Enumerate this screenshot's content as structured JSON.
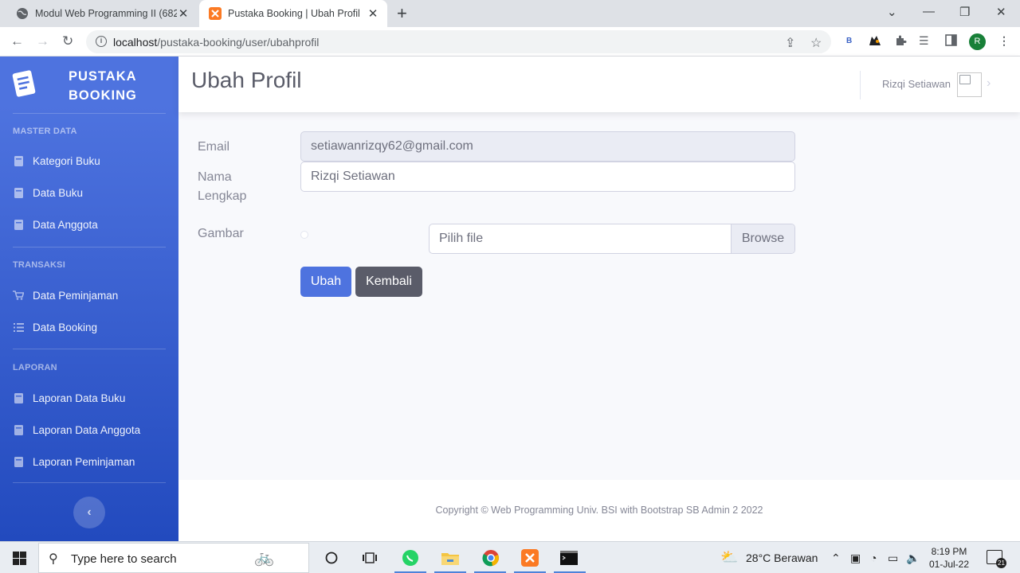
{
  "browser": {
    "tabs": [
      {
        "title": "Modul Web Programming II (682",
        "active": false,
        "icon": "globe-icon"
      },
      {
        "title": "Pustaka Booking | Ubah Profil",
        "active": true,
        "icon": "xampp-icon"
      }
    ],
    "url_host": "localhost",
    "url_path": "/pustaka-booking/user/ubahprofil",
    "profile_initial": "R",
    "extension_b": "B"
  },
  "sidebar": {
    "brand": {
      "line1": "PUSTAKA",
      "line2": "BOOKING"
    },
    "sections": [
      {
        "heading": "MASTER DATA",
        "items": [
          {
            "label": "Kategori Buku",
            "icon": "book-icon"
          },
          {
            "label": "Data Buku",
            "icon": "book-icon"
          },
          {
            "label": "Data Anggota",
            "icon": "book-icon"
          }
        ]
      },
      {
        "heading": "TRANSAKSI",
        "items": [
          {
            "label": "Data Peminjaman",
            "icon": "cart-icon"
          },
          {
            "label": "Data Booking",
            "icon": "list-icon"
          }
        ]
      },
      {
        "heading": "LAPORAN",
        "items": [
          {
            "label": "Laporan Data Buku",
            "icon": "book-icon"
          },
          {
            "label": "Laporan Data Anggota",
            "icon": "book-icon"
          },
          {
            "label": "Laporan Peminjaman",
            "icon": "book-icon"
          }
        ]
      }
    ],
    "toggle_icon": "chevron-left-icon"
  },
  "topbar": {
    "page_title": "Ubah Profil",
    "user_name": "Rizqi Setiawan"
  },
  "form": {
    "email_label": "Email",
    "email_value": "setiawanrizqy62@gmail.com",
    "name_label_1": "Nama",
    "name_label_2": "Lengkap",
    "name_value": "Rizqi Setiawan",
    "image_label": "Gambar",
    "file_placeholder": "Pilih file",
    "browse_label": "Browse",
    "submit_label": "Ubah",
    "back_label": "Kembali"
  },
  "footer": {
    "copyright": "Copyright © Web Programming Univ. BSI with Bootstrap SB Admin 2 2022"
  },
  "taskbar": {
    "search_placeholder": "Type here to search",
    "weather": "28°C  Berawan",
    "time": "8:19 PM",
    "date": "01-Jul-22",
    "notification_count": "21"
  },
  "colors": {
    "primary": "#4e73df",
    "secondary": "#5a5c69",
    "sidebar_start": "#4e73df",
    "sidebar_end": "#224abe"
  }
}
